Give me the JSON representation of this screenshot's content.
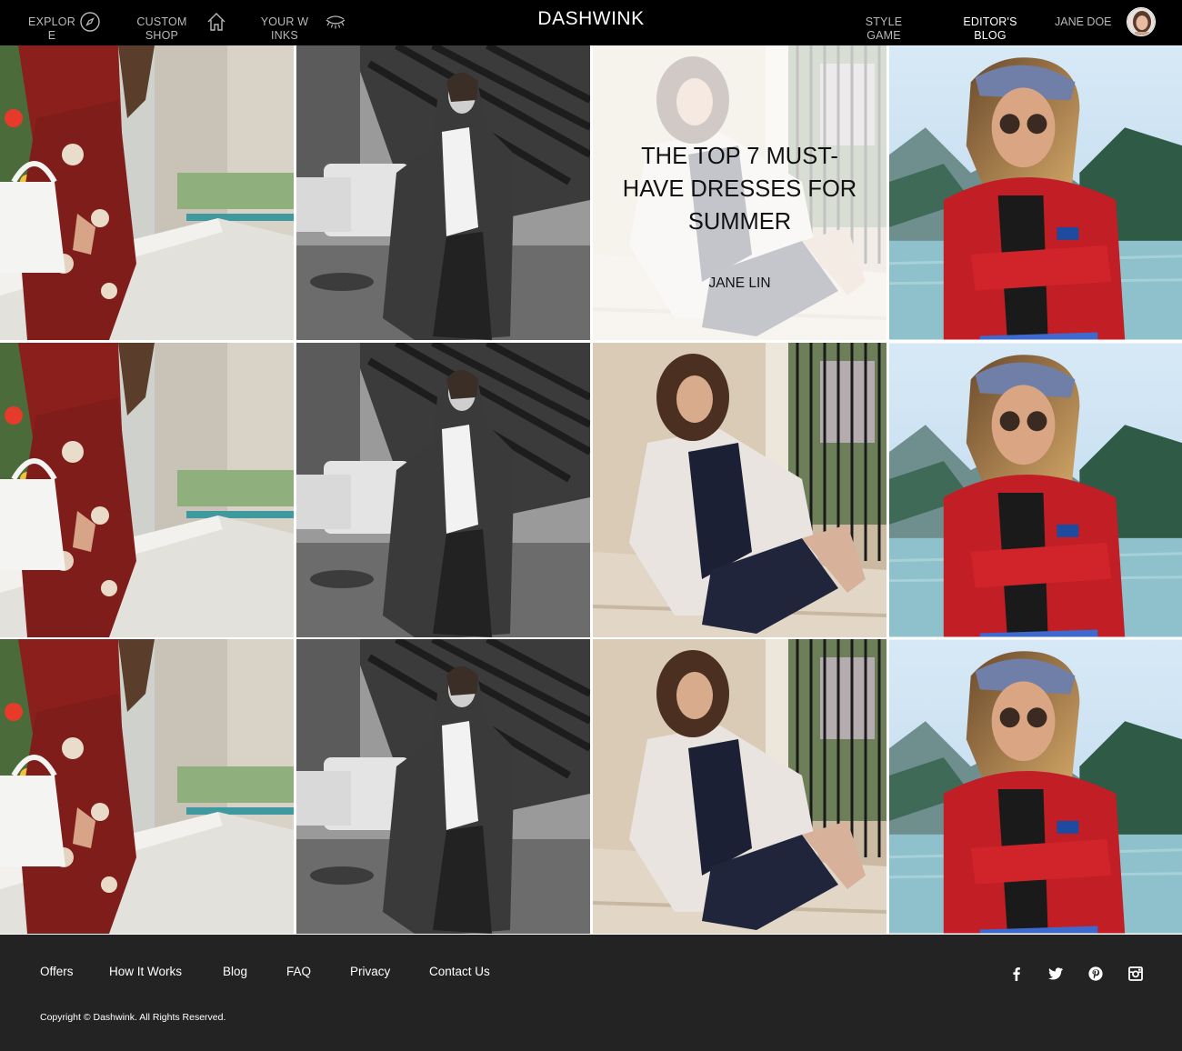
{
  "header": {
    "brand": "DASHWINK",
    "nav_left": [
      {
        "label": "EXPLORE",
        "icon": "compass-icon"
      },
      {
        "label": "CUSTOM SHOP",
        "icon": "home-icon"
      },
      {
        "label": "YOUR WINKS",
        "icon": "eye-wink-icon"
      }
    ],
    "nav_right": [
      {
        "label": "STYLE GAME",
        "active": false
      },
      {
        "label": "EDITOR'S BLOG",
        "active": true
      }
    ],
    "user_name": "JANE DOE",
    "avatar_icon": "user-avatar"
  },
  "feature": {
    "title": "THE TOP 7 MUST-HAVE DRESSES FOR SUMMER",
    "author": "JANE LIN"
  },
  "grid": {
    "rows": 3,
    "columns": 4,
    "photos": [
      "floral-dress-photo",
      "tweed-blazer-bw-photo",
      "velvet-dress-cardigan-photo",
      "red-jacket-lake-photo"
    ]
  },
  "footer": {
    "links": [
      "Offers",
      "How It Works",
      "Blog",
      "FAQ",
      "Privacy",
      "Contact Us"
    ],
    "social": [
      "facebook-icon",
      "twitter-icon",
      "pinterest-icon",
      "instagram-icon"
    ],
    "copyright": "Copyright © Dashwink. All Rights Reserved."
  },
  "colors": {
    "header_bg": "#000000",
    "footer_bg": "#232323",
    "nav_inactive": "#b9b9b9",
    "nav_active": "#ffffff"
  }
}
